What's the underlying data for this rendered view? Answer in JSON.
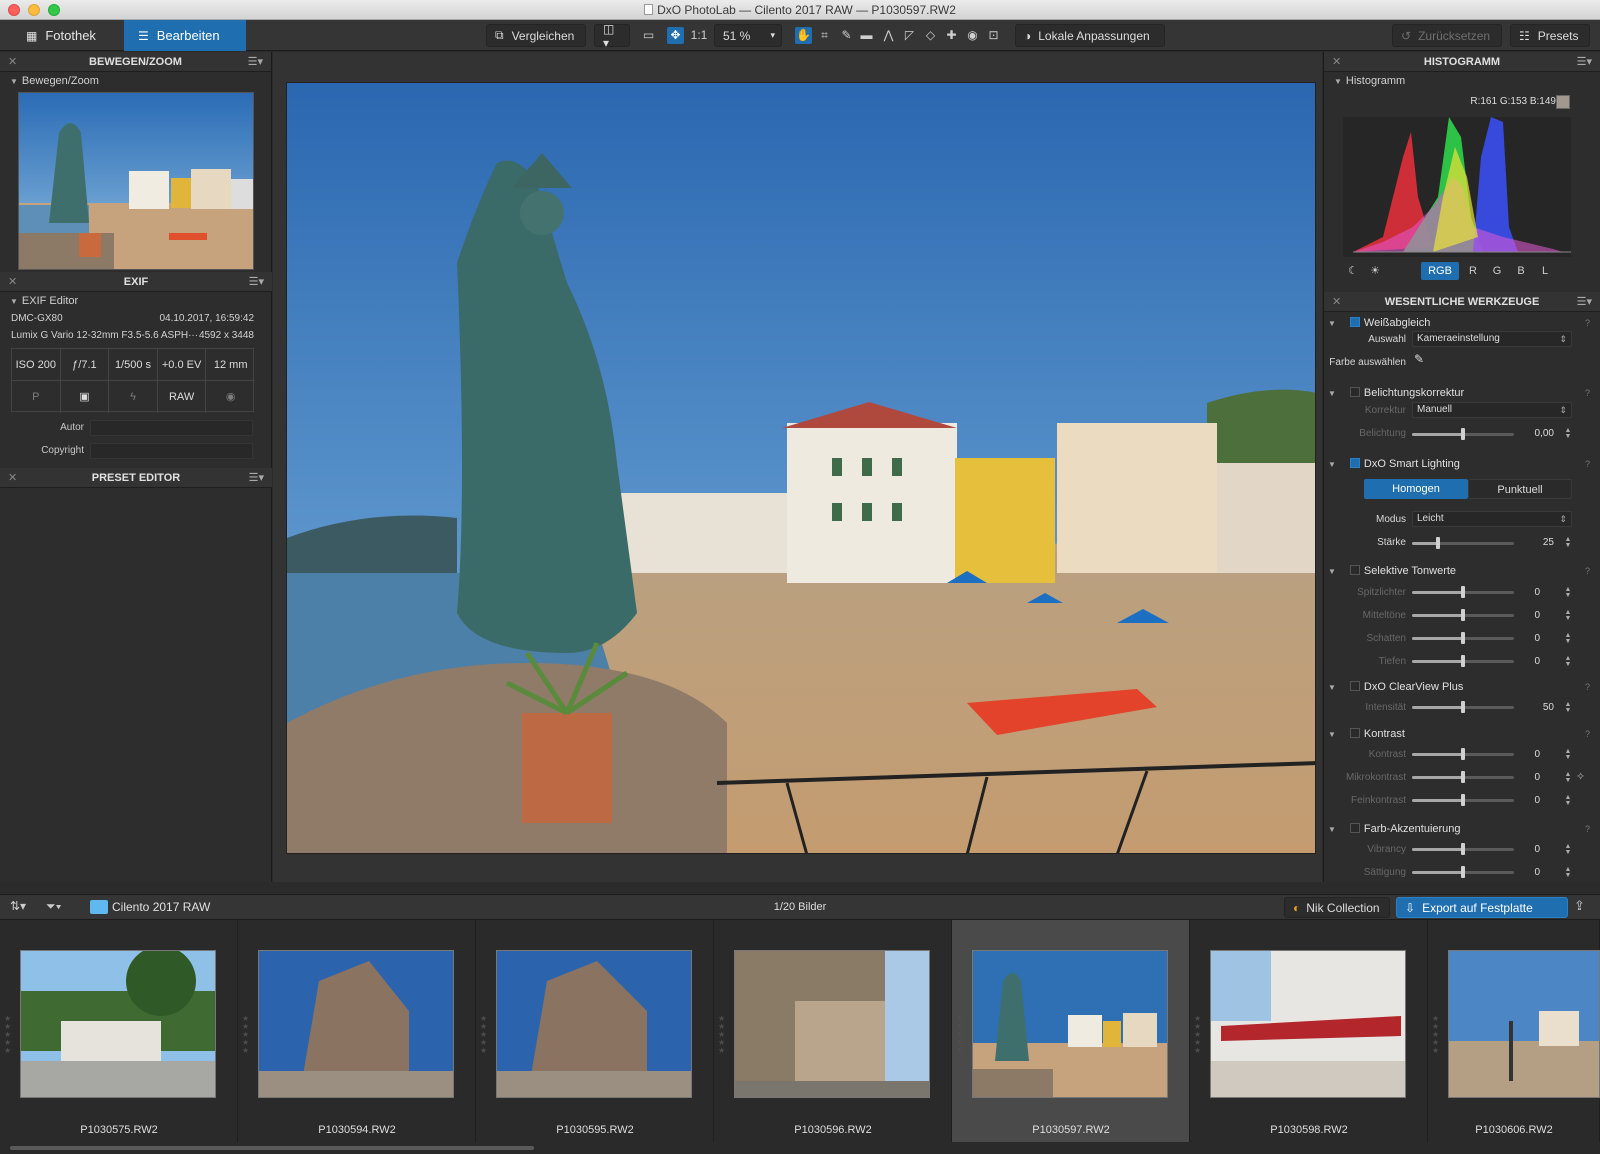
{
  "window": {
    "title": "DxO PhotoLab — Cilento 2017 RAW — P1030597.RW2"
  },
  "toolbar": {
    "tab_library": "Fotothek",
    "tab_edit": "Bearbeiten",
    "compare": "Vergleichen",
    "zoom_1to1": "1:1",
    "zoom_level": "51 %",
    "local_adjust": "Lokale Anpassungen",
    "reset": "Zurücksetzen",
    "presets": "Presets"
  },
  "left": {
    "move_zoom_title": "BEWEGEN/ZOOM",
    "move_zoom_sub": "Bewegen/Zoom",
    "exif_title": "EXIF",
    "exif_sub": "EXIF Editor",
    "camera": "DMC-GX80",
    "datetime": "04.10.2017, 16:59:42",
    "lens": "Lumix G Vario 12-32mm F3.5-5.6 ASPH···",
    "dimensions": "4592 x 3448",
    "iso": "ISO 200",
    "aperture": "ƒ/7.1",
    "shutter": "1/500 s",
    "ev": "+0.0 EV",
    "focal": "12 mm",
    "mode": "P",
    "raw": "RAW",
    "author_label": "Autor",
    "copyright_label": "Copyright",
    "preset_title": "PRESET EDITOR"
  },
  "histogram": {
    "title": "HISTOGRAMM",
    "sub": "Histogramm",
    "readout": "R:161 G:153 B:149",
    "channels": [
      "RGB",
      "R",
      "G",
      "B",
      "L"
    ]
  },
  "tools": {
    "title": "WESENTLICHE WERKZEUGE",
    "wb": "Weißabgleich",
    "wb_choice_label": "Auswahl",
    "wb_choice": "Kameraeinstellung",
    "wb_pick": "Farbe auswählen",
    "exposure": "Belichtungskorrektur",
    "exp_corr_label": "Korrektur",
    "exp_corr": "Manuell",
    "exp_label": "Belichtung",
    "exp_val": "0,00",
    "smart": "DxO Smart Lighting",
    "smart_homog": "Homogen",
    "smart_punkt": "Punktuell",
    "smart_mode_label": "Modus",
    "smart_mode": "Leicht",
    "smart_strength_label": "Stärke",
    "smart_strength": "25",
    "tones": "Selektive Tonwerte",
    "tone_high": "Spitzlichter",
    "tone_mid": "Mitteltöne",
    "tone_shadow": "Schatten",
    "tone_deep": "Tiefen",
    "zero": "0",
    "clearview": "DxO ClearView Plus",
    "cv_label": "Intensität",
    "cv_val": "50",
    "contrast": "Kontrast",
    "c_label": "Kontrast",
    "micro_label": "Mikrokontrast",
    "fine_label": "Feinkontrast",
    "color": "Farb-Akzentuierung",
    "vibrancy_label": "Vibrancy",
    "sat_label": "Sättigung"
  },
  "filmstrip": {
    "folder": "Cilento 2017 RAW",
    "count": "1/20 Bilder",
    "nik": "Nik Collection",
    "export": "Export auf Festplatte",
    "items": [
      "P1030575.RW2",
      "P1030594.RW2",
      "P1030595.RW2",
      "P1030596.RW2",
      "P1030597.RW2",
      "P1030598.RW2",
      "P1030606.RW2"
    ]
  },
  "colors": {
    "accent": "#1f6fb0",
    "panel": "#2d2d2d",
    "sky": "#2f6fb4",
    "sand": "#c8a47c"
  }
}
